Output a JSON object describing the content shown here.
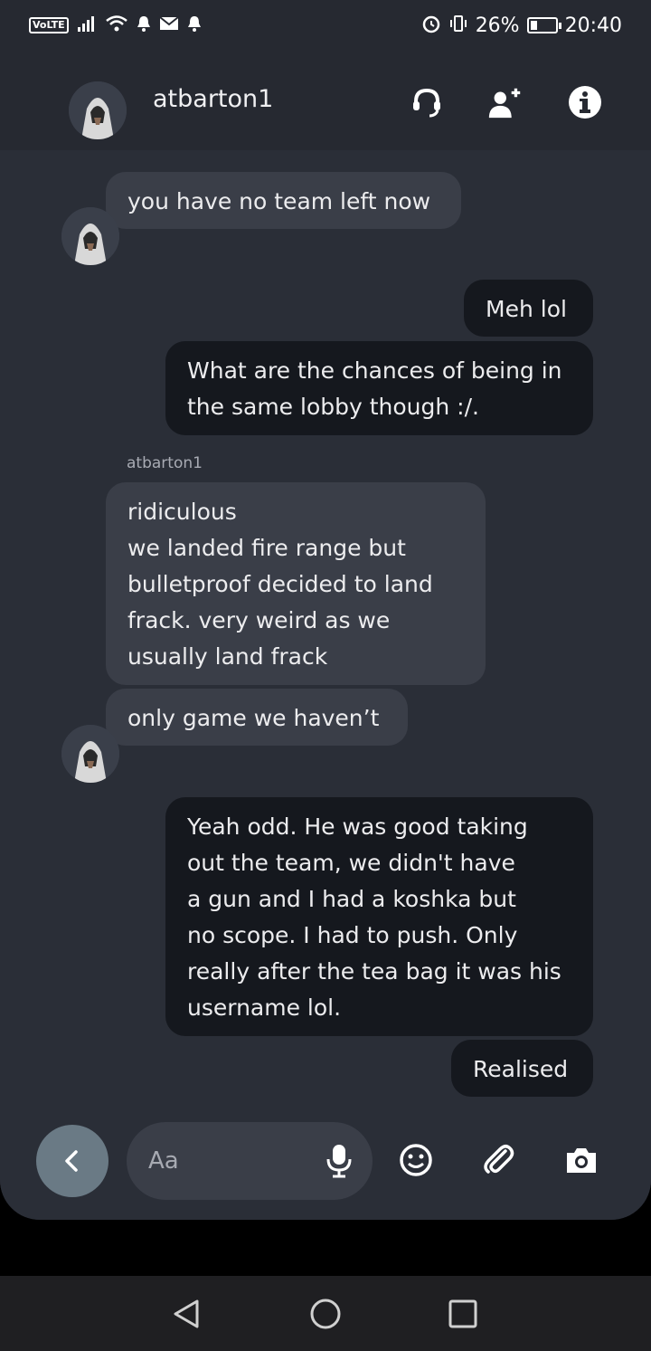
{
  "status_bar": {
    "network_badge": "VoLTE",
    "battery": "26%",
    "battery_level": 0.26,
    "time": "20:40"
  },
  "header": {
    "contact_name": "atbarton1",
    "icons": [
      "headset-icon",
      "add-person-icon",
      "info-icon"
    ]
  },
  "messages": [
    {
      "direction": "in",
      "text": "you have no team left now"
    },
    {
      "direction": "out",
      "text": "Meh lol"
    },
    {
      "direction": "out",
      "text": "What are the chances of being in\nthe same lobby though :/."
    },
    {
      "direction": "in",
      "text": "ridiculous\nwe landed fire range but\nbulletproof decided to land\nfrack. very weird as we\nusually land frack"
    },
    {
      "direction": "in",
      "text": "only game we haven’t"
    },
    {
      "direction": "out",
      "text": "Yeah odd. He was good taking\nout the team, we didn't have\na gun and I had a koshka but\nno scope. I had to push. Only\nreally after the tea bag it was his\nusername lol."
    },
    {
      "direction": "out",
      "text": "Realised"
    }
  ],
  "sender_label": "atbarton1",
  "composer": {
    "placeholder": "Aa",
    "tools": [
      "emoji-icon",
      "attach-icon",
      "camera-icon"
    ]
  },
  "colors": {
    "background": "#2a2e37",
    "incoming_bubble": "#3a3e48",
    "outgoing_bubble": "#15181e",
    "back_button": "#6a7a85"
  }
}
